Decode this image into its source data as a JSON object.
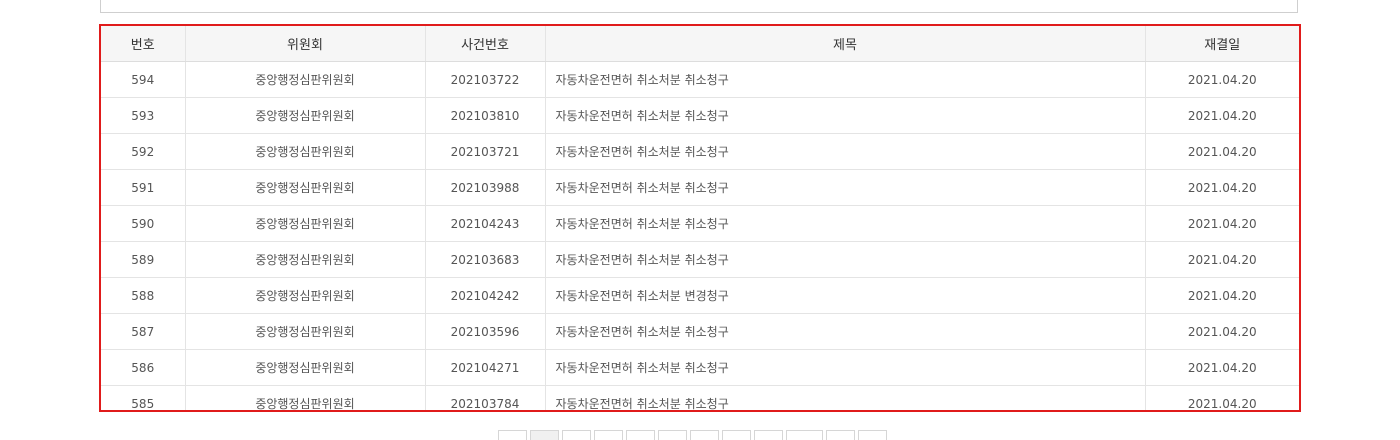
{
  "table": {
    "headers": [
      "번호",
      "위원회",
      "사건번호",
      "제목",
      "재결일"
    ],
    "rows": [
      {
        "no": "594",
        "committee": "중앙행정심판위원회",
        "case_no": "202103722",
        "title": "자동차운전면허 취소처분 취소청구",
        "date": "2021.04.20"
      },
      {
        "no": "593",
        "committee": "중앙행정심판위원회",
        "case_no": "202103810",
        "title": "자동차운전면허 취소처분 취소청구",
        "date": "2021.04.20"
      },
      {
        "no": "592",
        "committee": "중앙행정심판위원회",
        "case_no": "202103721",
        "title": "자동차운전면허 취소처분 취소청구",
        "date": "2021.04.20"
      },
      {
        "no": "591",
        "committee": "중앙행정심판위원회",
        "case_no": "202103988",
        "title": "자동차운전면허 취소처분 취소청구",
        "date": "2021.04.20"
      },
      {
        "no": "590",
        "committee": "중앙행정심판위원회",
        "case_no": "202104243",
        "title": "자동차운전면허 취소처분 취소청구",
        "date": "2021.04.20"
      },
      {
        "no": "589",
        "committee": "중앙행정심판위원회",
        "case_no": "202103683",
        "title": "자동차운전면허 취소처분 취소청구",
        "date": "2021.04.20"
      },
      {
        "no": "588",
        "committee": "중앙행정심판위원회",
        "case_no": "202104242",
        "title": "자동차운전면허 취소처분 변경청구",
        "date": "2021.04.20"
      },
      {
        "no": "587",
        "committee": "중앙행정심판위원회",
        "case_no": "202103596",
        "title": "자동차운전면허 취소처분 취소청구",
        "date": "2021.04.20"
      },
      {
        "no": "586",
        "committee": "중앙행정심판위원회",
        "case_no": "202104271",
        "title": "자동차운전면허 취소처분 취소청구",
        "date": "2021.04.20"
      },
      {
        "no": "585",
        "committee": "중앙행정심판위원회",
        "case_no": "202103784",
        "title": "자동차운전면허 취소처분 취소청구",
        "date": "2021.04.20"
      }
    ]
  },
  "colors": {
    "highlight_border": "#e01b1b",
    "header_bg": "#f6f6f6"
  }
}
